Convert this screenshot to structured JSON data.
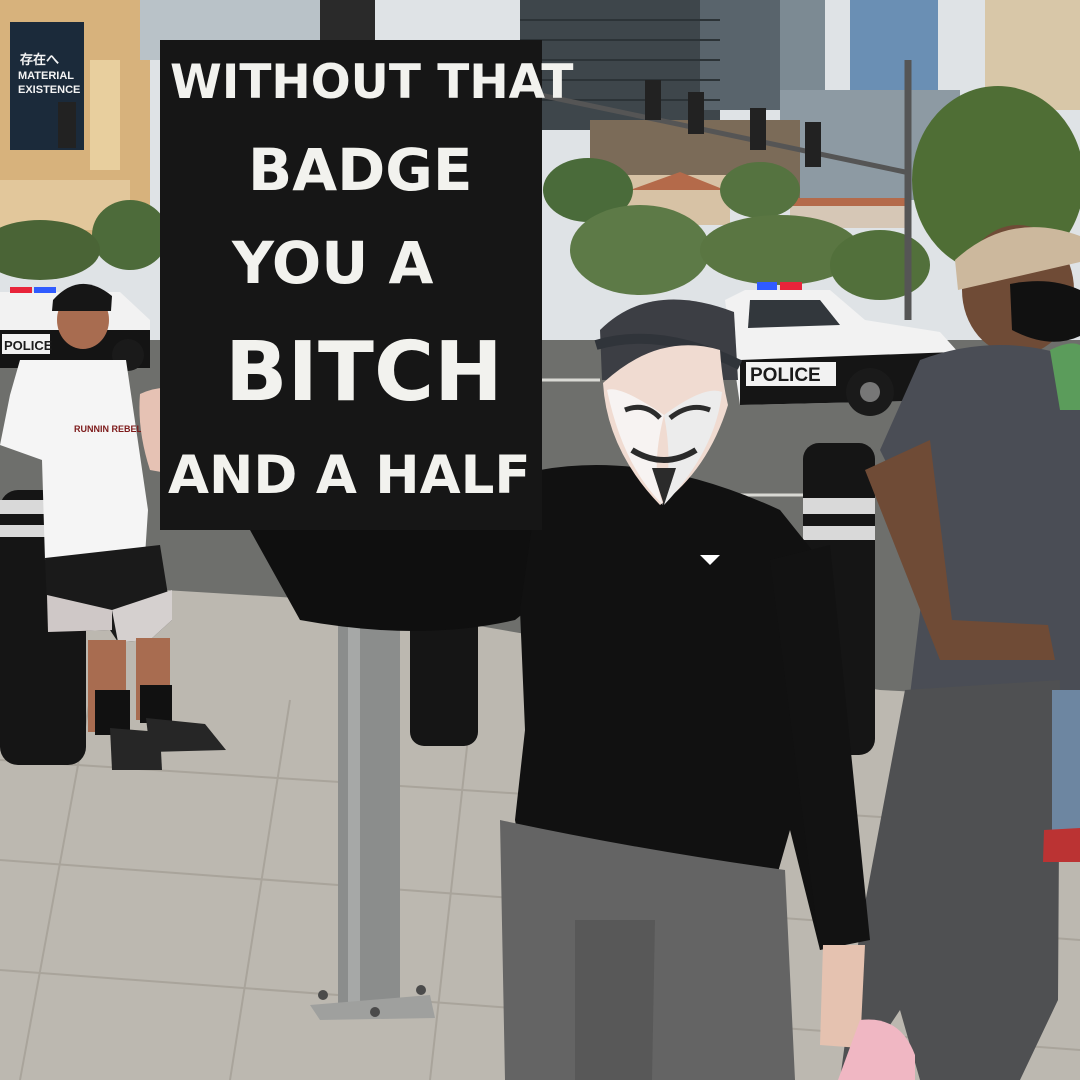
{
  "scene": {
    "description_free_labels": true
  },
  "protest_sign": {
    "lines": [
      "WITHOUT THAT",
      "BADGE",
      "YOU A",
      "BITCH",
      "AND A HALF"
    ],
    "background_color": "#161616",
    "text_color": "#f2f2ee"
  },
  "building_banner": {
    "line1": "存在へ",
    "line2": "MATERIAL",
    "line3": "EXISTENCE"
  },
  "police_cars": {
    "right_label": "POLICE",
    "left_label": "POLICE"
  },
  "shirt_print": {
    "line1": "RUNNIN REBELS"
  },
  "colors": {
    "sky": "#d9dde0",
    "street": "#6f6f6d",
    "sidewalk": "#bdb9b1",
    "tree": "#4f6b3a",
    "police_light_red": "#e8243a",
    "police_light_blue": "#2f5bff"
  }
}
